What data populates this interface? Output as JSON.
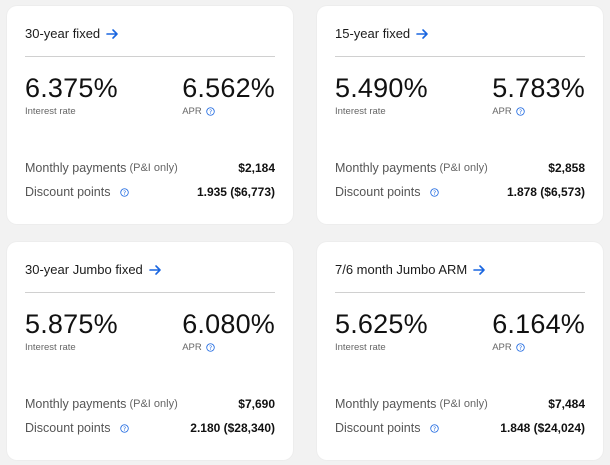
{
  "accent_color": "#1a66e0",
  "cards": [
    {
      "title": "30-year fixed",
      "interest_rate": "6.375%",
      "interest_rate_label": "Interest rate",
      "apr": "6.562%",
      "apr_label": "APR",
      "monthly_label": "Monthly payments",
      "monthly_suffix": "(P&I only)",
      "monthly_value": "$2,184",
      "discount_label": "Discount points",
      "discount_value": "1.935 ($6,773)"
    },
    {
      "title": "15-year fixed",
      "interest_rate": "5.490%",
      "interest_rate_label": "Interest rate",
      "apr": "5.783%",
      "apr_label": "APR",
      "monthly_label": "Monthly payments",
      "monthly_suffix": "(P&I only)",
      "monthly_value": "$2,858",
      "discount_label": "Discount points",
      "discount_value": "1.878 ($6,573)"
    },
    {
      "title": "30-year Jumbo fixed",
      "interest_rate": "5.875%",
      "interest_rate_label": "Interest rate",
      "apr": "6.080%",
      "apr_label": "APR",
      "monthly_label": "Monthly payments",
      "monthly_suffix": "(P&I only)",
      "monthly_value": "$7,690",
      "discount_label": "Discount points",
      "discount_value": "2.180 ($28,340)"
    },
    {
      "title": "7/6 month Jumbo ARM",
      "interest_rate": "5.625%",
      "interest_rate_label": "Interest rate",
      "apr": "6.164%",
      "apr_label": "APR",
      "monthly_label": "Monthly payments",
      "monthly_suffix": "(P&I only)",
      "monthly_value": "$7,484",
      "discount_label": "Discount points",
      "discount_value": "1.848 ($24,024)"
    }
  ]
}
